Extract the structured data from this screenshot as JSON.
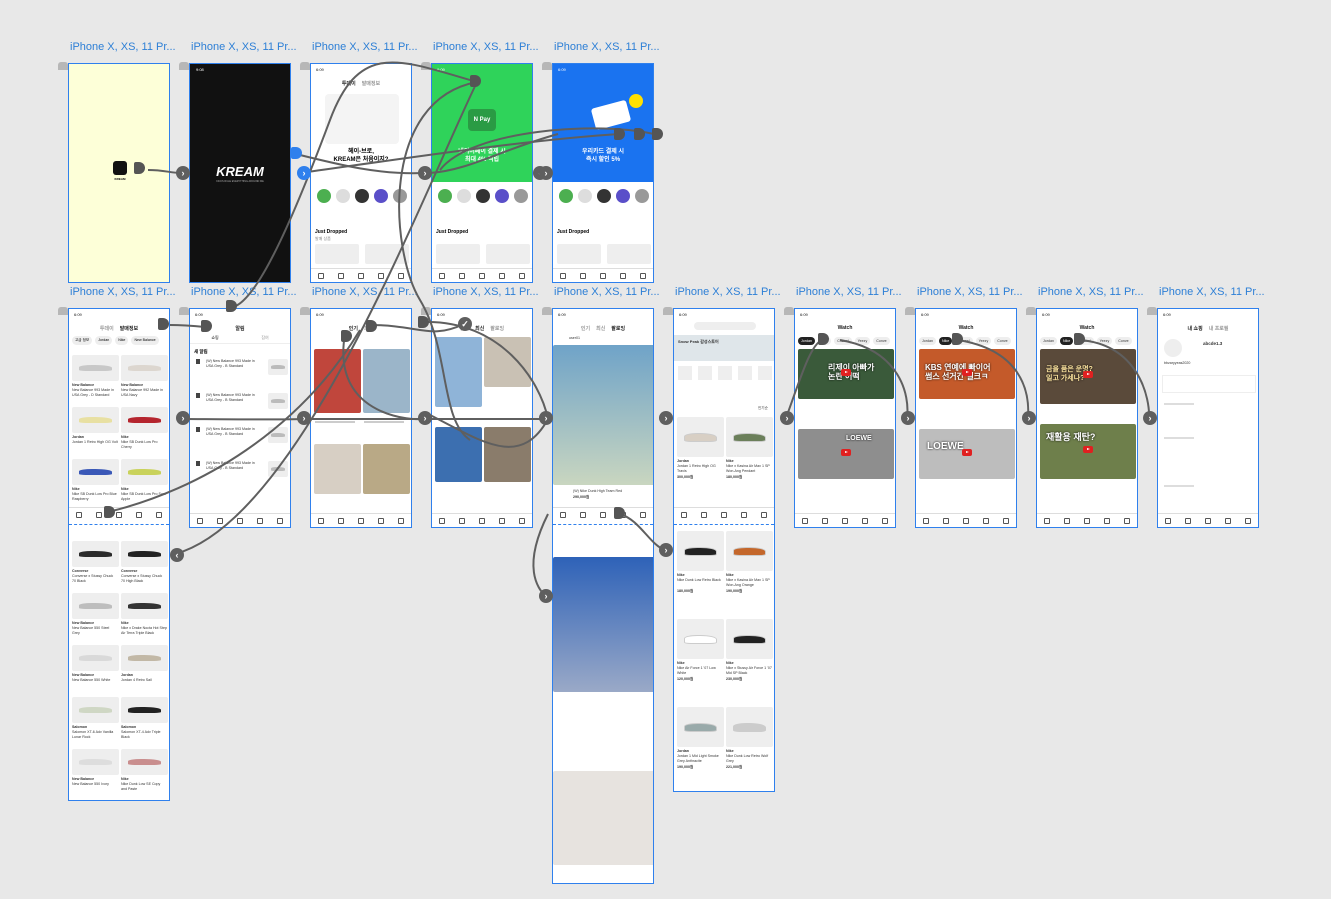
{
  "artboard_label": "iPhone X, XS, 11 Pr...",
  "splash": {
    "app_name": "KREAM",
    "app_caption": "KREAM"
  },
  "dark": {
    "logo": "KREAM",
    "tagline": "KICKS RULE EVERYTHING AROUND ME",
    "time": "9:08"
  },
  "status_time": "6:09",
  "home": {
    "tabs": [
      "투데이",
      "발매정보"
    ],
    "promo1": "헤이-브로,\nKREAM은 처음이지?",
    "promo2": "네이버페이 결제 시\n최대 4% 적립",
    "promo3": "우리카드 결제 시\n즉시 할인 5%",
    "pay_brand": "N Pay",
    "section": "Just Dropped",
    "section_sub": "발매 상품",
    "cats": [
      "NEW",
      "Luxury",
      "나이키",
      "블루",
      "뉴발란스"
    ]
  },
  "filters": [
    "고급 정보",
    "Jordan",
    "Nike",
    "New Balance"
  ],
  "notice": {
    "title": "알림",
    "tabs": [
      "쇼핑",
      "참여"
    ],
    "section": "새 알림",
    "item": "(W) New Balance 993 Made in USA Grey - B Standard"
  },
  "style": {
    "tabs": [
      "인기",
      "최신",
      "팔로잉"
    ]
  },
  "shop": {
    "brand": "Snow Peak 감성스토어",
    "sort": "인기순"
  },
  "watch": {
    "title": "Watch",
    "chips": [
      "Jordan",
      "Nike",
      "Chanel",
      "Yeezy",
      "Conve"
    ]
  },
  "my": {
    "tabs": [
      "내 쇼핑",
      "내 프로필"
    ],
    "user": "abcde1.3",
    "email": "bbzaryyeas2020"
  },
  "thumbs": {
    "t1": "리제이 아빠가\n논란 어떡",
    "t2": "KBS 연예에 빠이어\n썸스 선거간 셀크ㅋ",
    "t3": "금을 품은 운명?\n일고 가세나?",
    "t4": "재활용 재탄?",
    "t5": "LOEWE",
    "t6": "LOEWE"
  },
  "products": [
    {
      "brand": "Jordan",
      "name": "Jordan 1 Retro High OG Travis",
      "price": "300,000원"
    },
    {
      "brand": "Nike",
      "name": "Nike x Kasina Air Max 1 SP Won-Ang Pendant",
      "price": "180,000원"
    },
    {
      "brand": "Nike",
      "name": "Nike Dunk Low Retro Black",
      "price": "180,000원"
    },
    {
      "brand": "Nike",
      "name": "Nike x Kasina Air Max 1 SP Won-Ang Orange",
      "price": "190,000원"
    },
    {
      "brand": "Nike",
      "name": "Nike Air Force 1 '07 Low White",
      "price": "120,000원"
    },
    {
      "brand": "Nike",
      "name": "Nike x Stussy Air Force 1 '07 Mid SP Black",
      "price": "230,000원"
    },
    {
      "brand": "Jordan",
      "name": "Jordan 1 Mid Light Smoke Grey Anthracite",
      "price": "190,000원"
    },
    {
      "brand": "Nike",
      "name": "Nike Dunk Low Retro Wolf Grey",
      "price": "221,000원"
    }
  ],
  "list_products": [
    {
      "brand": "New Balance",
      "name": "New Balance 993 Made in USA Grey - D Standard"
    },
    {
      "brand": "New Balance",
      "name": "New Balance 992 Made in USA Navy"
    },
    {
      "brand": "Jordan",
      "name": "Jordan 1 Retro High OG Volt"
    },
    {
      "brand": "Nike",
      "name": "Nike SB Dunk Low Pro Cherry"
    },
    {
      "brand": "Nike",
      "name": "Nike SB Dunk Low Pro Blue Raspberry"
    },
    {
      "brand": "Nike",
      "name": "Nike SB Dunk Low Pro Sour Apple"
    },
    {
      "brand": "Converse",
      "name": "Converse x Stussy Chuck 70 Black"
    },
    {
      "brand": "Converse",
      "name": "Converse x Stussy Chuck 70 High Black"
    },
    {
      "brand": "New Balance",
      "name": "New Balance 550 Steel Grey"
    },
    {
      "brand": "Nike",
      "name": "Nike x Drake Nocta Hot Step Air Terra Triple Black"
    },
    {
      "brand": "New Balance",
      "name": "New Balance 550 White"
    },
    {
      "brand": "Jordan",
      "name": "Jordan 4 Retro Sail"
    },
    {
      "brand": "Salomon",
      "name": "Salomon XT-6 Adv Vanilla Lunar Rock"
    },
    {
      "brand": "Salomon",
      "name": "Salomon XT-4 Adv Triple Black"
    },
    {
      "brand": "New Balance",
      "name": "New Balance 550 Ivory"
    },
    {
      "brand": "Nike",
      "name": "Nike Dunk Low SE Copy and Paste"
    }
  ],
  "post": {
    "user": "user01",
    "product": "(W) Nike Dunk High Team Red",
    "price": "290,000원"
  },
  "colors": {
    "artboard_border": "#2f80ed",
    "canvas": "#e8e8e8",
    "connector": "#5f5f5f",
    "splash_bg": "#fdffd8",
    "naver_green": "#2fd35a",
    "woori_blue": "#1a73f0"
  }
}
